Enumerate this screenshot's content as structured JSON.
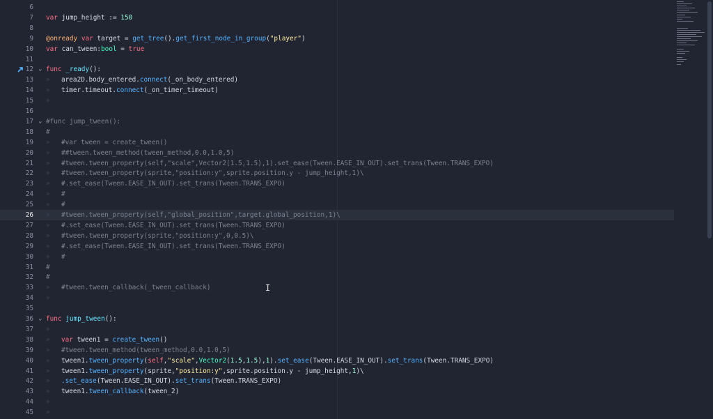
{
  "lines": [
    {
      "n": 6,
      "segs": []
    },
    {
      "n": 7,
      "segs": [
        {
          "t": "var",
          "c": "kw"
        },
        {
          "t": " jump_height := "
        },
        {
          "t": "150",
          "c": "num"
        }
      ]
    },
    {
      "n": 8,
      "segs": []
    },
    {
      "n": 9,
      "segs": [
        {
          "t": "@onready",
          "c": "ann"
        },
        {
          "t": " "
        },
        {
          "t": "var",
          "c": "kw"
        },
        {
          "t": " target = "
        },
        {
          "t": "get_tree",
          "c": "fn"
        },
        {
          "t": "()."
        },
        {
          "t": "get_first_node_in_group",
          "c": "fn"
        },
        {
          "t": "("
        },
        {
          "t": "\"player\"",
          "c": "str"
        },
        {
          "t": ")"
        }
      ]
    },
    {
      "n": 10,
      "segs": [
        {
          "t": "var",
          "c": "kw"
        },
        {
          "t": " can_tween:"
        },
        {
          "t": "bool",
          "c": "type"
        },
        {
          "t": " = "
        },
        {
          "t": "true",
          "c": "bool"
        }
      ]
    },
    {
      "n": 11,
      "segs": []
    },
    {
      "n": 12,
      "fold": true,
      "marker": true,
      "segs": [
        {
          "t": "func",
          "c": "kw"
        },
        {
          "t": " "
        },
        {
          "t": "_ready",
          "c": "fndef"
        },
        {
          "t": "():"
        }
      ]
    },
    {
      "n": 13,
      "tabs": 1,
      "segs": [
        {
          "t": "area2D.body_entered."
        },
        {
          "t": "connect",
          "c": "fn"
        },
        {
          "t": "(_on_body_entered)"
        }
      ]
    },
    {
      "n": 14,
      "tabs": 1,
      "segs": [
        {
          "t": "timer.timeout."
        },
        {
          "t": "connect",
          "c": "fn"
        },
        {
          "t": "(_on_timer_timeout)"
        }
      ]
    },
    {
      "n": 15,
      "tabs": 1,
      "segs": []
    },
    {
      "n": 16,
      "segs": []
    },
    {
      "n": 17,
      "fold": true,
      "segs": [
        {
          "t": "#func jump_tween():",
          "c": "cm"
        }
      ]
    },
    {
      "n": 18,
      "segs": [
        {
          "t": "#",
          "c": "cm"
        }
      ]
    },
    {
      "n": 19,
      "tabs": 1,
      "segs": [
        {
          "t": "#var tween = create_tween()",
          "c": "cm"
        }
      ]
    },
    {
      "n": 20,
      "tabs": 1,
      "segs": [
        {
          "t": "##tween.tween_method(tween_method,0.0,1.0,5)",
          "c": "cm"
        }
      ]
    },
    {
      "n": 21,
      "tabs": 1,
      "segs": [
        {
          "t": "#tween.tween_property(self,\"scale\",Vector2(1.5,1.5),1).set_ease(Tween.EASE_IN_OUT).set_trans(Tween.TRANS_EXPO)",
          "c": "cm"
        }
      ]
    },
    {
      "n": 22,
      "tabs": 1,
      "segs": [
        {
          "t": "#tween.tween_property(sprite,\"position:y\",sprite.position.y - jump_height,1)\\",
          "c": "cm"
        }
      ]
    },
    {
      "n": 23,
      "tabs": 1,
      "segs": [
        {
          "t": "#.set_ease(Tween.EASE_IN_OUT).set_trans(Tween.TRANS_EXPO)",
          "c": "cm"
        }
      ]
    },
    {
      "n": 24,
      "tabs": 1,
      "segs": [
        {
          "t": "#",
          "c": "cm"
        }
      ]
    },
    {
      "n": 25,
      "tabs": 1,
      "segs": [
        {
          "t": "#",
          "c": "cm"
        }
      ]
    },
    {
      "n": 26,
      "tabs": 1,
      "current": true,
      "segs": [
        {
          "t": "#tween.tween_property(self,\"global_position\",target.global_position,1)\\",
          "c": "cm"
        }
      ]
    },
    {
      "n": 27,
      "tabs": 1,
      "segs": [
        {
          "t": "#.set_ease(Tween.EASE_IN_OUT).set_trans(Tween.TRANS_EXPO)",
          "c": "cm"
        }
      ]
    },
    {
      "n": 28,
      "tabs": 1,
      "segs": [
        {
          "t": "#tween.tween_property(sprite,\"position:y\",0,0.5)\\",
          "c": "cm"
        }
      ]
    },
    {
      "n": 29,
      "tabs": 1,
      "segs": [
        {
          "t": "#.set_ease(Tween.EASE_IN_OUT).set_trans(Tween.TRANS_EXPO)",
          "c": "cm"
        }
      ]
    },
    {
      "n": 30,
      "tabs": 1,
      "segs": [
        {
          "t": "#",
          "c": "cm"
        }
      ]
    },
    {
      "n": 31,
      "segs": [
        {
          "t": "#",
          "c": "cm"
        }
      ]
    },
    {
      "n": 32,
      "segs": [
        {
          "t": "#",
          "c": "cm"
        }
      ]
    },
    {
      "n": 33,
      "tabs": 1,
      "segs": [
        {
          "t": "#tween.tween_callback(_tween_callback)",
          "c": "cm"
        }
      ]
    },
    {
      "n": 34,
      "tabs": 1,
      "segs": []
    },
    {
      "n": 35,
      "segs": []
    },
    {
      "n": 36,
      "fold": true,
      "segs": [
        {
          "t": "func",
          "c": "kw"
        },
        {
          "t": " "
        },
        {
          "t": "jump_tween",
          "c": "fndef"
        },
        {
          "t": "():"
        }
      ]
    },
    {
      "n": 37,
      "tabs": 1,
      "segs": []
    },
    {
      "n": 38,
      "tabs": 1,
      "segs": [
        {
          "t": "var",
          "c": "kw"
        },
        {
          "t": " tween1 = "
        },
        {
          "t": "create_tween",
          "c": "fn"
        },
        {
          "t": "()"
        }
      ]
    },
    {
      "n": 39,
      "tabs": 1,
      "segs": [
        {
          "t": "#tween.tween_method(tween_method,0.0,1.0,5)",
          "c": "cm"
        }
      ]
    },
    {
      "n": 40,
      "tabs": 1,
      "segs": [
        {
          "t": "tween1."
        },
        {
          "t": "tween_property",
          "c": "fn"
        },
        {
          "t": "("
        },
        {
          "t": "self",
          "c": "kw"
        },
        {
          "t": ","
        },
        {
          "t": "\"scale\"",
          "c": "str"
        },
        {
          "t": ","
        },
        {
          "t": "Vector2",
          "c": "type"
        },
        {
          "t": "("
        },
        {
          "t": "1.5",
          "c": "num"
        },
        {
          "t": ","
        },
        {
          "t": "1.5",
          "c": "num"
        },
        {
          "t": "),"
        },
        {
          "t": "1",
          "c": "num"
        },
        {
          "t": ")."
        },
        {
          "t": "set_ease",
          "c": "fn"
        },
        {
          "t": "(Tween.EASE_IN_OUT)."
        },
        {
          "t": "set_trans",
          "c": "fn"
        },
        {
          "t": "(Tween.TRANS_EXPO)"
        }
      ]
    },
    {
      "n": 41,
      "tabs": 1,
      "segs": [
        {
          "t": "tween1."
        },
        {
          "t": "tween_property",
          "c": "fn"
        },
        {
          "t": "(sprite,"
        },
        {
          "t": "\"position:y\"",
          "c": "str"
        },
        {
          "t": ",sprite.position.y - jump_height,"
        },
        {
          "t": "1",
          "c": "num"
        },
        {
          "t": ")\\"
        }
      ]
    },
    {
      "n": 42,
      "tabs": 1,
      "segs": [
        {
          "t": ".set_ease",
          "c": "fn"
        },
        {
          "t": "(Tween.EASE_IN_OUT)."
        },
        {
          "t": "set_trans",
          "c": "fn"
        },
        {
          "t": "(Tween.TRANS_EXPO)"
        }
      ]
    },
    {
      "n": 43,
      "tabs": 1,
      "segs": [
        {
          "t": "tween1."
        },
        {
          "t": "tween_callback",
          "c": "fn"
        },
        {
          "t": "(tween_2)"
        }
      ]
    },
    {
      "n": 44,
      "tabs": 1,
      "segs": []
    },
    {
      "n": 45,
      "tabs": 1,
      "segs": []
    }
  ],
  "colors": {
    "background": "#202531",
    "keyword": "#ff7085",
    "function": "#57b3ff",
    "string": "#ffeda1",
    "comment": "#7d8290",
    "number": "#a1ffe0"
  },
  "icons": {
    "fold": "chevron-down-icon",
    "override": "override-arrow-icon",
    "cursor": "text-cursor-icon"
  }
}
